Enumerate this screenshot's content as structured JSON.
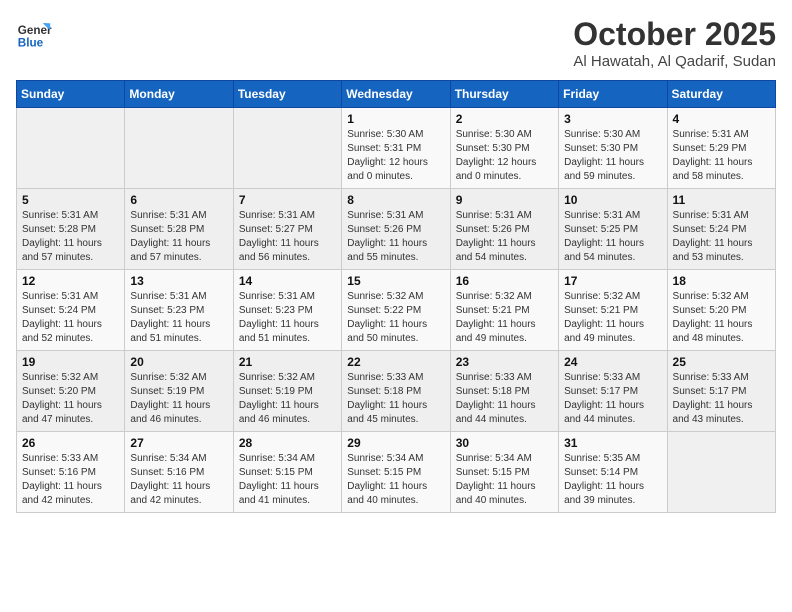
{
  "header": {
    "logo_general": "General",
    "logo_blue": "Blue",
    "month_title": "October 2025",
    "location": "Al Hawatah, Al Qadarif, Sudan"
  },
  "weekdays": [
    "Sunday",
    "Monday",
    "Tuesday",
    "Wednesday",
    "Thursday",
    "Friday",
    "Saturday"
  ],
  "weeks": [
    [
      {
        "day": "",
        "info": ""
      },
      {
        "day": "",
        "info": ""
      },
      {
        "day": "",
        "info": ""
      },
      {
        "day": "1",
        "info": "Sunrise: 5:30 AM\nSunset: 5:31 PM\nDaylight: 12 hours\nand 0 minutes."
      },
      {
        "day": "2",
        "info": "Sunrise: 5:30 AM\nSunset: 5:30 PM\nDaylight: 12 hours\nand 0 minutes."
      },
      {
        "day": "3",
        "info": "Sunrise: 5:30 AM\nSunset: 5:30 PM\nDaylight: 11 hours\nand 59 minutes."
      },
      {
        "day": "4",
        "info": "Sunrise: 5:31 AM\nSunset: 5:29 PM\nDaylight: 11 hours\nand 58 minutes."
      }
    ],
    [
      {
        "day": "5",
        "info": "Sunrise: 5:31 AM\nSunset: 5:28 PM\nDaylight: 11 hours\nand 57 minutes."
      },
      {
        "day": "6",
        "info": "Sunrise: 5:31 AM\nSunset: 5:28 PM\nDaylight: 11 hours\nand 57 minutes."
      },
      {
        "day": "7",
        "info": "Sunrise: 5:31 AM\nSunset: 5:27 PM\nDaylight: 11 hours\nand 56 minutes."
      },
      {
        "day": "8",
        "info": "Sunrise: 5:31 AM\nSunset: 5:26 PM\nDaylight: 11 hours\nand 55 minutes."
      },
      {
        "day": "9",
        "info": "Sunrise: 5:31 AM\nSunset: 5:26 PM\nDaylight: 11 hours\nand 54 minutes."
      },
      {
        "day": "10",
        "info": "Sunrise: 5:31 AM\nSunset: 5:25 PM\nDaylight: 11 hours\nand 54 minutes."
      },
      {
        "day": "11",
        "info": "Sunrise: 5:31 AM\nSunset: 5:24 PM\nDaylight: 11 hours\nand 53 minutes."
      }
    ],
    [
      {
        "day": "12",
        "info": "Sunrise: 5:31 AM\nSunset: 5:24 PM\nDaylight: 11 hours\nand 52 minutes."
      },
      {
        "day": "13",
        "info": "Sunrise: 5:31 AM\nSunset: 5:23 PM\nDaylight: 11 hours\nand 51 minutes."
      },
      {
        "day": "14",
        "info": "Sunrise: 5:31 AM\nSunset: 5:23 PM\nDaylight: 11 hours\nand 51 minutes."
      },
      {
        "day": "15",
        "info": "Sunrise: 5:32 AM\nSunset: 5:22 PM\nDaylight: 11 hours\nand 50 minutes."
      },
      {
        "day": "16",
        "info": "Sunrise: 5:32 AM\nSunset: 5:21 PM\nDaylight: 11 hours\nand 49 minutes."
      },
      {
        "day": "17",
        "info": "Sunrise: 5:32 AM\nSunset: 5:21 PM\nDaylight: 11 hours\nand 49 minutes."
      },
      {
        "day": "18",
        "info": "Sunrise: 5:32 AM\nSunset: 5:20 PM\nDaylight: 11 hours\nand 48 minutes."
      }
    ],
    [
      {
        "day": "19",
        "info": "Sunrise: 5:32 AM\nSunset: 5:20 PM\nDaylight: 11 hours\nand 47 minutes."
      },
      {
        "day": "20",
        "info": "Sunrise: 5:32 AM\nSunset: 5:19 PM\nDaylight: 11 hours\nand 46 minutes."
      },
      {
        "day": "21",
        "info": "Sunrise: 5:32 AM\nSunset: 5:19 PM\nDaylight: 11 hours\nand 46 minutes."
      },
      {
        "day": "22",
        "info": "Sunrise: 5:33 AM\nSunset: 5:18 PM\nDaylight: 11 hours\nand 45 minutes."
      },
      {
        "day": "23",
        "info": "Sunrise: 5:33 AM\nSunset: 5:18 PM\nDaylight: 11 hours\nand 44 minutes."
      },
      {
        "day": "24",
        "info": "Sunrise: 5:33 AM\nSunset: 5:17 PM\nDaylight: 11 hours\nand 44 minutes."
      },
      {
        "day": "25",
        "info": "Sunrise: 5:33 AM\nSunset: 5:17 PM\nDaylight: 11 hours\nand 43 minutes."
      }
    ],
    [
      {
        "day": "26",
        "info": "Sunrise: 5:33 AM\nSunset: 5:16 PM\nDaylight: 11 hours\nand 42 minutes."
      },
      {
        "day": "27",
        "info": "Sunrise: 5:34 AM\nSunset: 5:16 PM\nDaylight: 11 hours\nand 42 minutes."
      },
      {
        "day": "28",
        "info": "Sunrise: 5:34 AM\nSunset: 5:15 PM\nDaylight: 11 hours\nand 41 minutes."
      },
      {
        "day": "29",
        "info": "Sunrise: 5:34 AM\nSunset: 5:15 PM\nDaylight: 11 hours\nand 40 minutes."
      },
      {
        "day": "30",
        "info": "Sunrise: 5:34 AM\nSunset: 5:15 PM\nDaylight: 11 hours\nand 40 minutes."
      },
      {
        "day": "31",
        "info": "Sunrise: 5:35 AM\nSunset: 5:14 PM\nDaylight: 11 hours\nand 39 minutes."
      },
      {
        "day": "",
        "info": ""
      }
    ]
  ]
}
